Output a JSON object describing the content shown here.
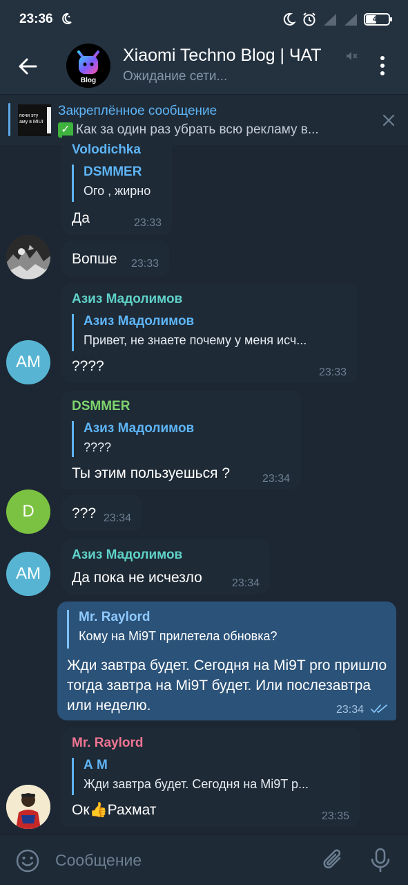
{
  "status": {
    "time": "23:36",
    "battery": "47",
    "battery_level": 0.47
  },
  "header": {
    "title": "Xiaomi Techno Blog | ЧАТ",
    "status": "Ожидание сети...",
    "logo_text": "Blog"
  },
  "pinned": {
    "title": "Закреплённое сообщение",
    "text": "Как за один раз убрать всю рекламу в...",
    "thumb_text": "почи эту\nаму в MIUI"
  },
  "messages": [
    {
      "sender": "Volodichka",
      "reply_name": "DSMMER",
      "reply_text": "Ого , жирно",
      "text": "Да",
      "time": "23:33"
    },
    {
      "text": "Вопше",
      "time": "23:33"
    },
    {
      "sender": "Азиз Мадолимов",
      "reply_name": "Азиз Мадолимов",
      "reply_text": "Привет, не знаете почему у меня исч...",
      "text": "????",
      "time": "23:33",
      "avatar": "AM"
    },
    {
      "sender": "DSMMER",
      "reply_name": "Азиз Мадолимов",
      "reply_text": "????",
      "text": "Ты этим пользуешься ?",
      "time": "23:34"
    },
    {
      "text": "???",
      "time": "23:34",
      "avatar": "D"
    },
    {
      "sender": "Азиз Мадолимов",
      "text": "Да пока не исчезло",
      "time": "23:34",
      "avatar": "AM"
    },
    {
      "reply_name": "Mr. Raylord",
      "reply_text": "Кому на Mi9T прилетела обновка?",
      "text": "Жди завтра будет. Сегодня на Mi9T pro пришло тогда завтра на Mi9T будет. Или послезавтра или неделю.",
      "time": "23:34"
    },
    {
      "sender": "Mr. Raylord",
      "reply_name": "А М",
      "reply_text": "Жди завтра будет. Сегодня на Mi9T р...",
      "text": "Ок👍Рахмат",
      "time": "23:35"
    }
  ],
  "input": {
    "placeholder": "Сообщение"
  },
  "colors": {
    "background": "#1d2733",
    "bubble_in": "#1e2a36",
    "bubble_out": "#2b5278",
    "link_blue": "#5eb5f7",
    "name_teal": "#5fd2c9",
    "name_green": "#7fd56e",
    "name_pink": "#ef7592",
    "avatar_am": "#57b5d3",
    "avatar_d": "#7cc242"
  }
}
